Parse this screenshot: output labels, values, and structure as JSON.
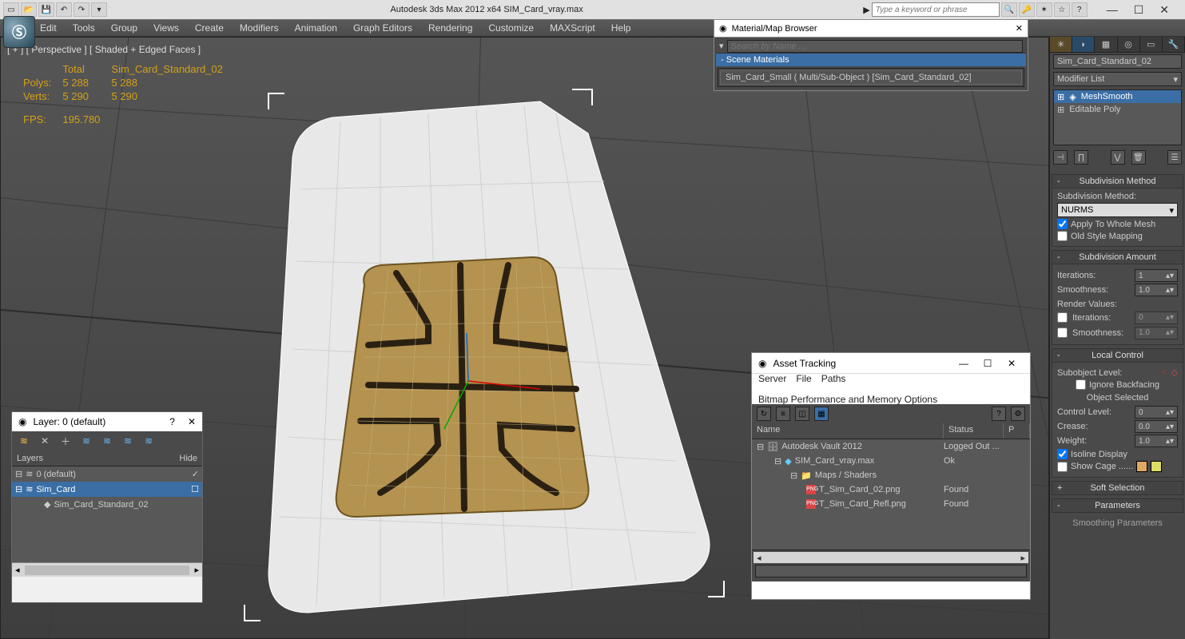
{
  "title_bar": {
    "app_title": "Autodesk 3ds Max  2012 x64     SIM_Card_vray.max",
    "search_placeholder": "Type a keyword or phrase"
  },
  "menu": {
    "items": [
      "Edit",
      "Tools",
      "Group",
      "Views",
      "Create",
      "Modifiers",
      "Animation",
      "Graph Editors",
      "Rendering",
      "Customize",
      "MAXScript",
      "Help"
    ]
  },
  "viewport": {
    "label": "[ + ] [ Perspective ] [ Shaded + Edged Faces ]",
    "stats": {
      "col_total": "Total",
      "col_name": "Sim_Card_Standard_02",
      "polys_label": "Polys:",
      "polys_total": "5 288",
      "polys_sel": "5 288",
      "verts_label": "Verts:",
      "verts_total": "5 290",
      "verts_sel": "5 290",
      "fps_label": "FPS:",
      "fps_val": "195.780"
    }
  },
  "material_browser": {
    "title": "Material/Map Browser",
    "search_placeholder": "Search by Name ...",
    "section": "- Scene Materials",
    "item": "Sim_Card_Small  ( Multi/Sub-Object )  [Sim_Card_Standard_02]"
  },
  "layer_panel": {
    "title": "Layer: 0 (default)",
    "help": "?",
    "col_layers": "Layers",
    "col_hide": "Hide",
    "rows": [
      {
        "name": "0 (default)",
        "indent": 0,
        "sel": false
      },
      {
        "name": "Sim_Card",
        "indent": 0,
        "sel": true
      },
      {
        "name": "Sim_Card_Standard_02",
        "indent": 1,
        "sel": false
      }
    ]
  },
  "asset_panel": {
    "title": "Asset Tracking",
    "menu": [
      "Server",
      "File",
      "Paths",
      "Bitmap Performance and Memory Options"
    ],
    "head_name": "Name",
    "head_status": "Status",
    "head_p": "P",
    "rows": [
      {
        "name": "Autodesk Vault 2012",
        "status": "Logged Out ...",
        "indent": 0,
        "icon": "vault"
      },
      {
        "name": "SIM_Card_vray.max",
        "status": "Ok",
        "indent": 1,
        "icon": "max"
      },
      {
        "name": "Maps / Shaders",
        "status": "",
        "indent": 2,
        "icon": "folder"
      },
      {
        "name": "T_Sim_Card_02.png",
        "status": "Found",
        "indent": 3,
        "icon": "png"
      },
      {
        "name": "T_Sim_Card_Refl.png",
        "status": "Found",
        "indent": 3,
        "icon": "png"
      }
    ]
  },
  "command_panel": {
    "obj_name": "Sim_Card_Standard_02",
    "modlist_label": "Modifier List",
    "stack": [
      {
        "name": "MeshSmooth",
        "selected": true,
        "exp": true
      },
      {
        "name": "Editable Poly",
        "selected": false,
        "exp": true
      }
    ],
    "rollouts": {
      "subdiv_method": {
        "title": "Subdivision Method",
        "label": "Subdivision Method:",
        "value": "NURMS",
        "apply_whole": "Apply To Whole Mesh",
        "old_style": "Old Style Mapping"
      },
      "subdiv_amount": {
        "title": "Subdivision Amount",
        "iter_label": "Iterations:",
        "iter_val": "1",
        "smooth_label": "Smoothness:",
        "smooth_val": "1.0",
        "render_label": "Render Values:",
        "r_iter_val": "0",
        "r_smooth_val": "1.0"
      },
      "local_control": {
        "title": "Local Control",
        "sublevel_label": "Subobject Level:",
        "ignore_back": "Ignore Backfacing",
        "obj_sel": "Object Selected",
        "ctrl_level_label": "Control Level:",
        "ctrl_level_val": "0",
        "crease_label": "Crease:",
        "crease_val": "0.0",
        "weight_label": "Weight:",
        "weight_val": "1.0",
        "isoline": "Isoline Display",
        "show_cage": "Show Cage ......"
      },
      "soft_selection": {
        "title": "Soft Selection"
      },
      "parameters": {
        "title": "Parameters"
      },
      "smoothing_params": {
        "title": "Smoothing Parameters"
      }
    }
  }
}
